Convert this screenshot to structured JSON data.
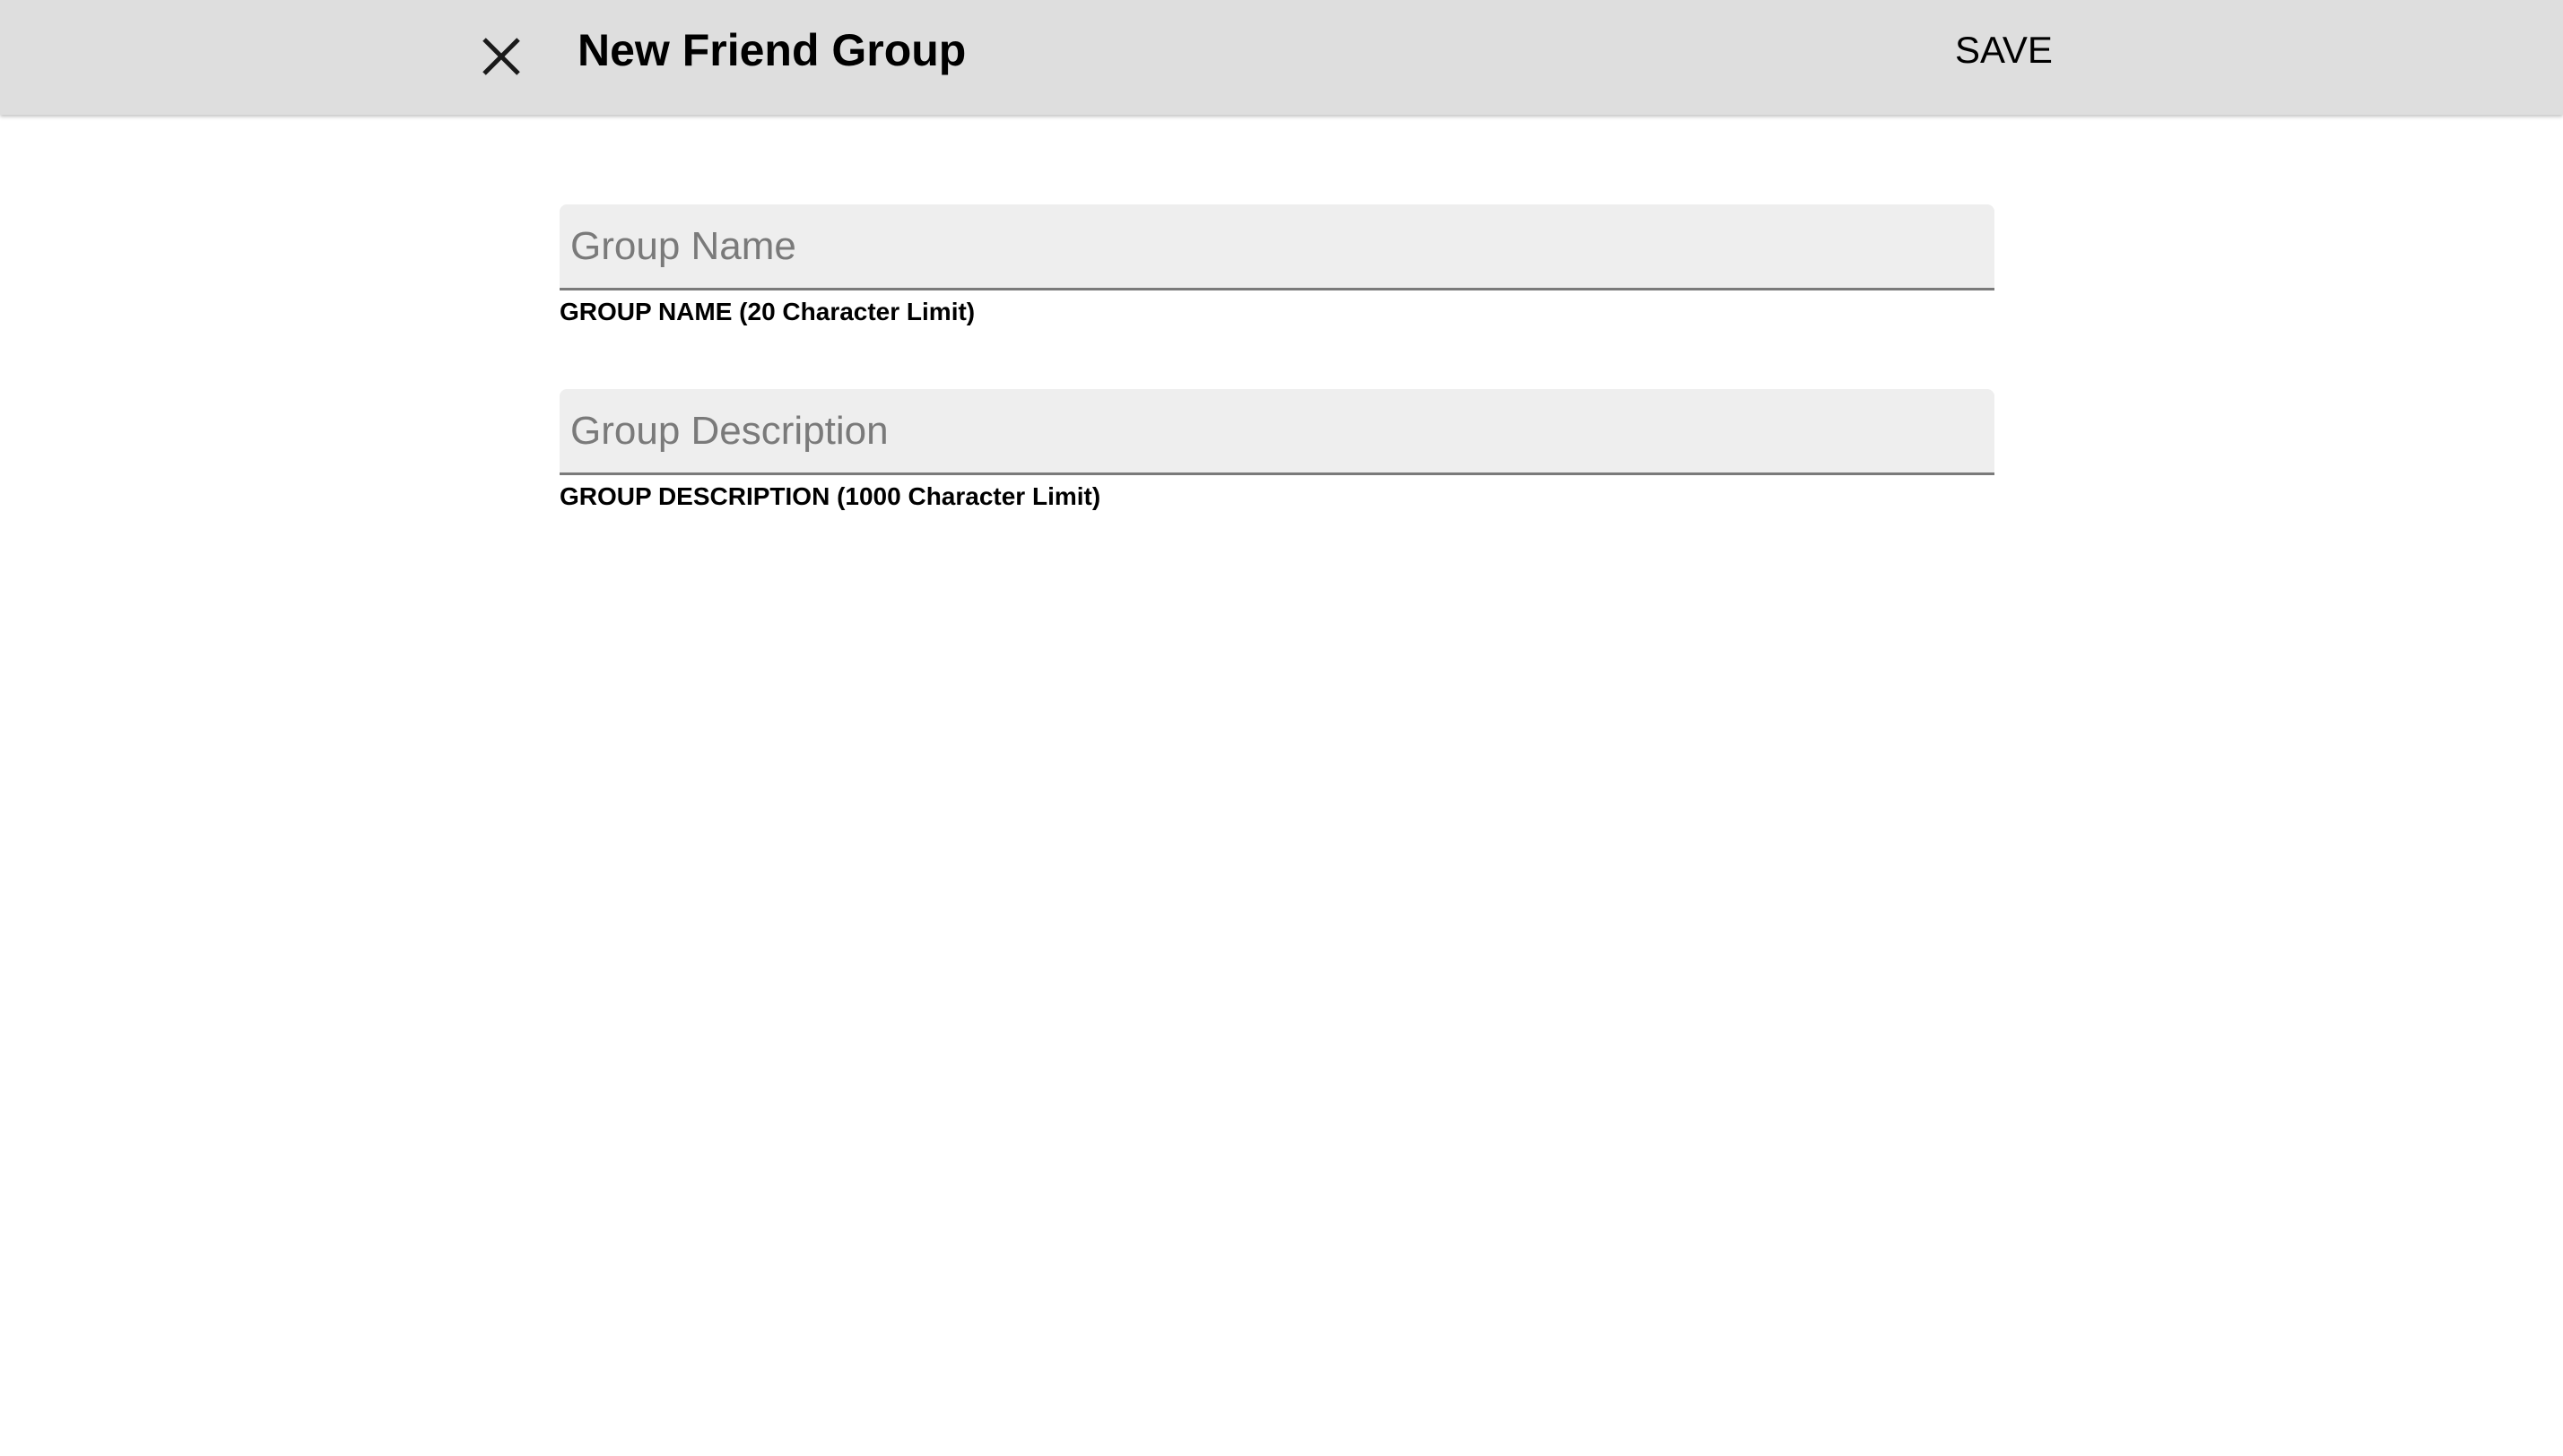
{
  "header": {
    "close_icon": "close-icon",
    "title": "New Friend Group",
    "save_label": "SAVE"
  },
  "form": {
    "group_name": {
      "value": "",
      "placeholder": "Group Name",
      "label": "GROUP NAME (20 Character Limit)"
    },
    "group_description": {
      "value": "",
      "placeholder": "Group Description",
      "label": "GROUP DESCRIPTION (1000 Character Limit)"
    }
  },
  "colors": {
    "header_background": "#dedede",
    "input_background": "#eeeeee",
    "input_underline": "#7a7a7a",
    "placeholder_text": "#7a7a7a",
    "page_background": "#ffffff"
  }
}
